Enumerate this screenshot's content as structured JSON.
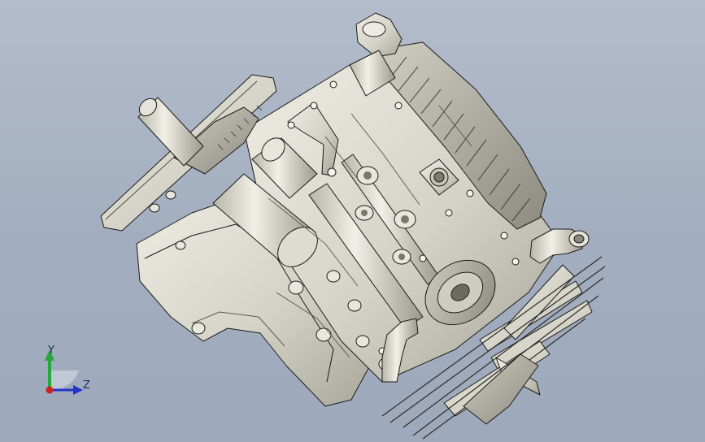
{
  "viewport": {
    "background_top": "#b3bccb",
    "background_bottom": "#9eaabc"
  },
  "model": {
    "part_fill": "#d9d7cc",
    "part_shade": "#a9a79b",
    "part_dark": "#6f6d63",
    "edge_color": "#1b1b18"
  },
  "triad": {
    "y_label": "Y",
    "z_label": "Z",
    "y_color": "#25a83a",
    "z_color": "#2233cc",
    "origin_color": "#cc2222"
  }
}
